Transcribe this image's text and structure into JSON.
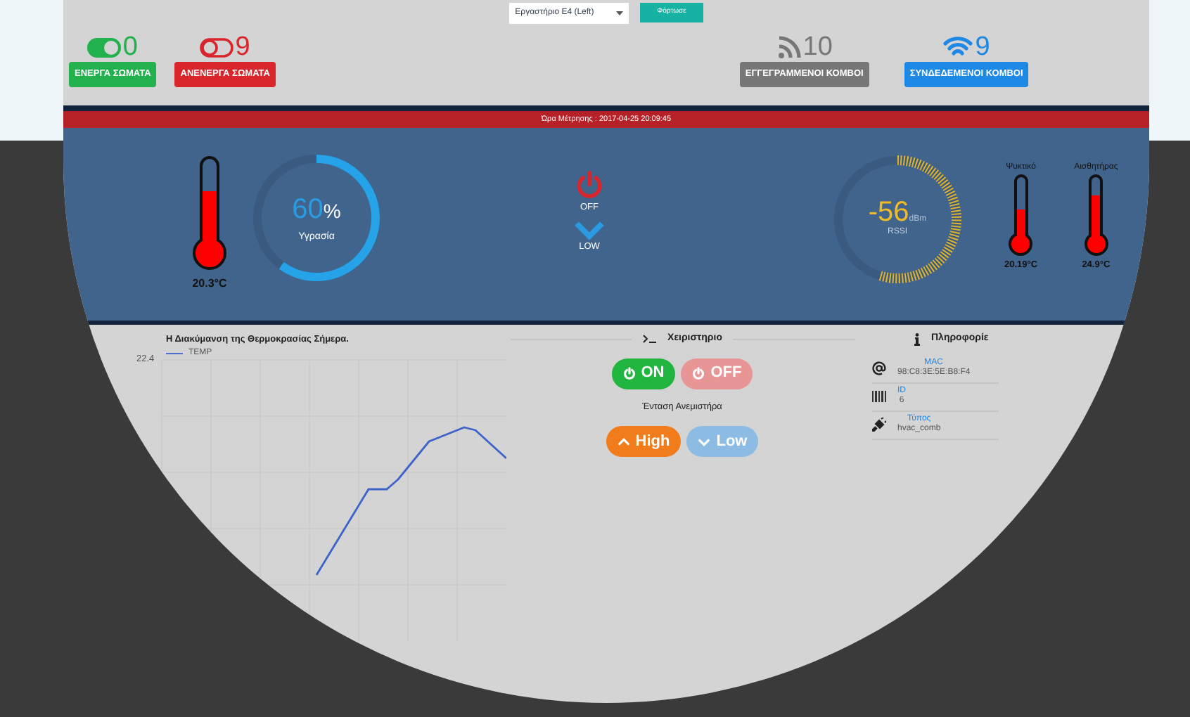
{
  "page_selector": {
    "value": "Εργαστήριο Ε4 (Left)",
    "button": "Φόρτωσε"
  },
  "counters": [
    {
      "kind": "toggle",
      "count": "0",
      "label": "ΕΝΕΡΓΑ ΣΩΜΑΤΑ",
      "color": "#22b14c"
    },
    {
      "kind": "toggle-off",
      "count": "9",
      "label": "ΑΝΕΝΕΡΓΑ ΣΩΜΑΤΑ",
      "color": "#d9262c"
    },
    {
      "kind": "rss",
      "count": "10",
      "label": "ΕΓΓΕΓΡΑΜΜΕΝΟΙ ΚΟΜΒΟΙ",
      "color": "#777777"
    },
    {
      "kind": "wifi",
      "count": "9",
      "label": "ΣΥΝΔΕΔΕΜΕΝΟΙ ΚΟΜΒΟΙ",
      "color": "#1e88e5"
    }
  ],
  "timestamp_bar": "Ώρα Μέτρησης : 2017-04-25 20:09:45",
  "sensors": {
    "main_thermometer": {
      "level": 0.6,
      "reading": "20.3°C"
    },
    "humidity": {
      "value": "60",
      "unit": "%",
      "label": "Υγρασία",
      "level": 0.6
    },
    "fan_status": {
      "power": "OFF",
      "speed": "LOW"
    },
    "rssi": {
      "value": "-56",
      "unit": "dBm",
      "label": "RSSI",
      "level": 0.55
    },
    "thermometers": [
      {
        "label": "Ψυκτικό",
        "level": 0.45,
        "reading": "20.19°C"
      },
      {
        "label": "Αισθητήρας",
        "level": 0.7,
        "reading": "24.9°C"
      }
    ]
  },
  "chart": {
    "title": "Η Διακύμανση της Θερμοκρασίας Σήμερα.",
    "legend": "TEMP",
    "top_value": "22.4"
  },
  "control": {
    "title": "Χειριστηριο",
    "power_buttons": [
      {
        "kind": "on",
        "label": "ON",
        "selected": true
      },
      {
        "kind": "off",
        "label": "OFF",
        "selected": false
      }
    ],
    "fan_label": "Ένταση Ανεμιστήρα",
    "fan_buttons": [
      {
        "kind": "up",
        "label": "High",
        "selected": true
      },
      {
        "kind": "down",
        "label": "Low",
        "selected": false
      }
    ]
  },
  "info": {
    "title": "Πληροφορίε",
    "items": [
      {
        "kind": "at",
        "label": "MAC",
        "value": "98:C8:3E:5E:B8:F4"
      },
      {
        "kind": "barcode",
        "label": "ID",
        "value": "6"
      },
      {
        "kind": "plug",
        "label": "Τύπος",
        "value": "hvac_comb"
      }
    ]
  }
}
